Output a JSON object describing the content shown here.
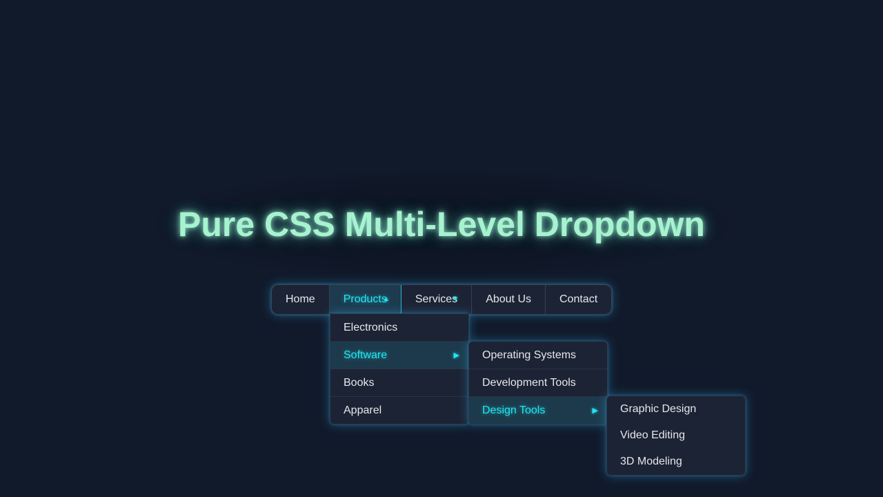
{
  "page": {
    "title": "Pure CSS Multi-Level Dropdown"
  },
  "nav": {
    "items": [
      {
        "label": "Home"
      },
      {
        "label": "Products",
        "active": true
      },
      {
        "label": "Services"
      },
      {
        "label": "About Us"
      },
      {
        "label": "Contact"
      }
    ],
    "caret_icon": "triangle-down-icon"
  },
  "products_menu": {
    "items": [
      {
        "label": "Electronics"
      },
      {
        "label": "Software",
        "active": true,
        "has_submenu": true
      },
      {
        "label": "Books"
      },
      {
        "label": "Apparel"
      }
    ]
  },
  "software_menu": {
    "items": [
      {
        "label": "Operating Systems"
      },
      {
        "label": "Development Tools"
      },
      {
        "label": "Design Tools",
        "active": true,
        "has_submenu": true
      }
    ]
  },
  "design_tools_menu": {
    "items": [
      {
        "label": "Graphic Design"
      },
      {
        "label": "Video Editing"
      },
      {
        "label": "3D Modeling"
      }
    ]
  },
  "theme": {
    "background": "#111a2b",
    "accent": "#22e6f0",
    "title_color": "#a7f3d0",
    "text_color": "#e5e7eb"
  }
}
